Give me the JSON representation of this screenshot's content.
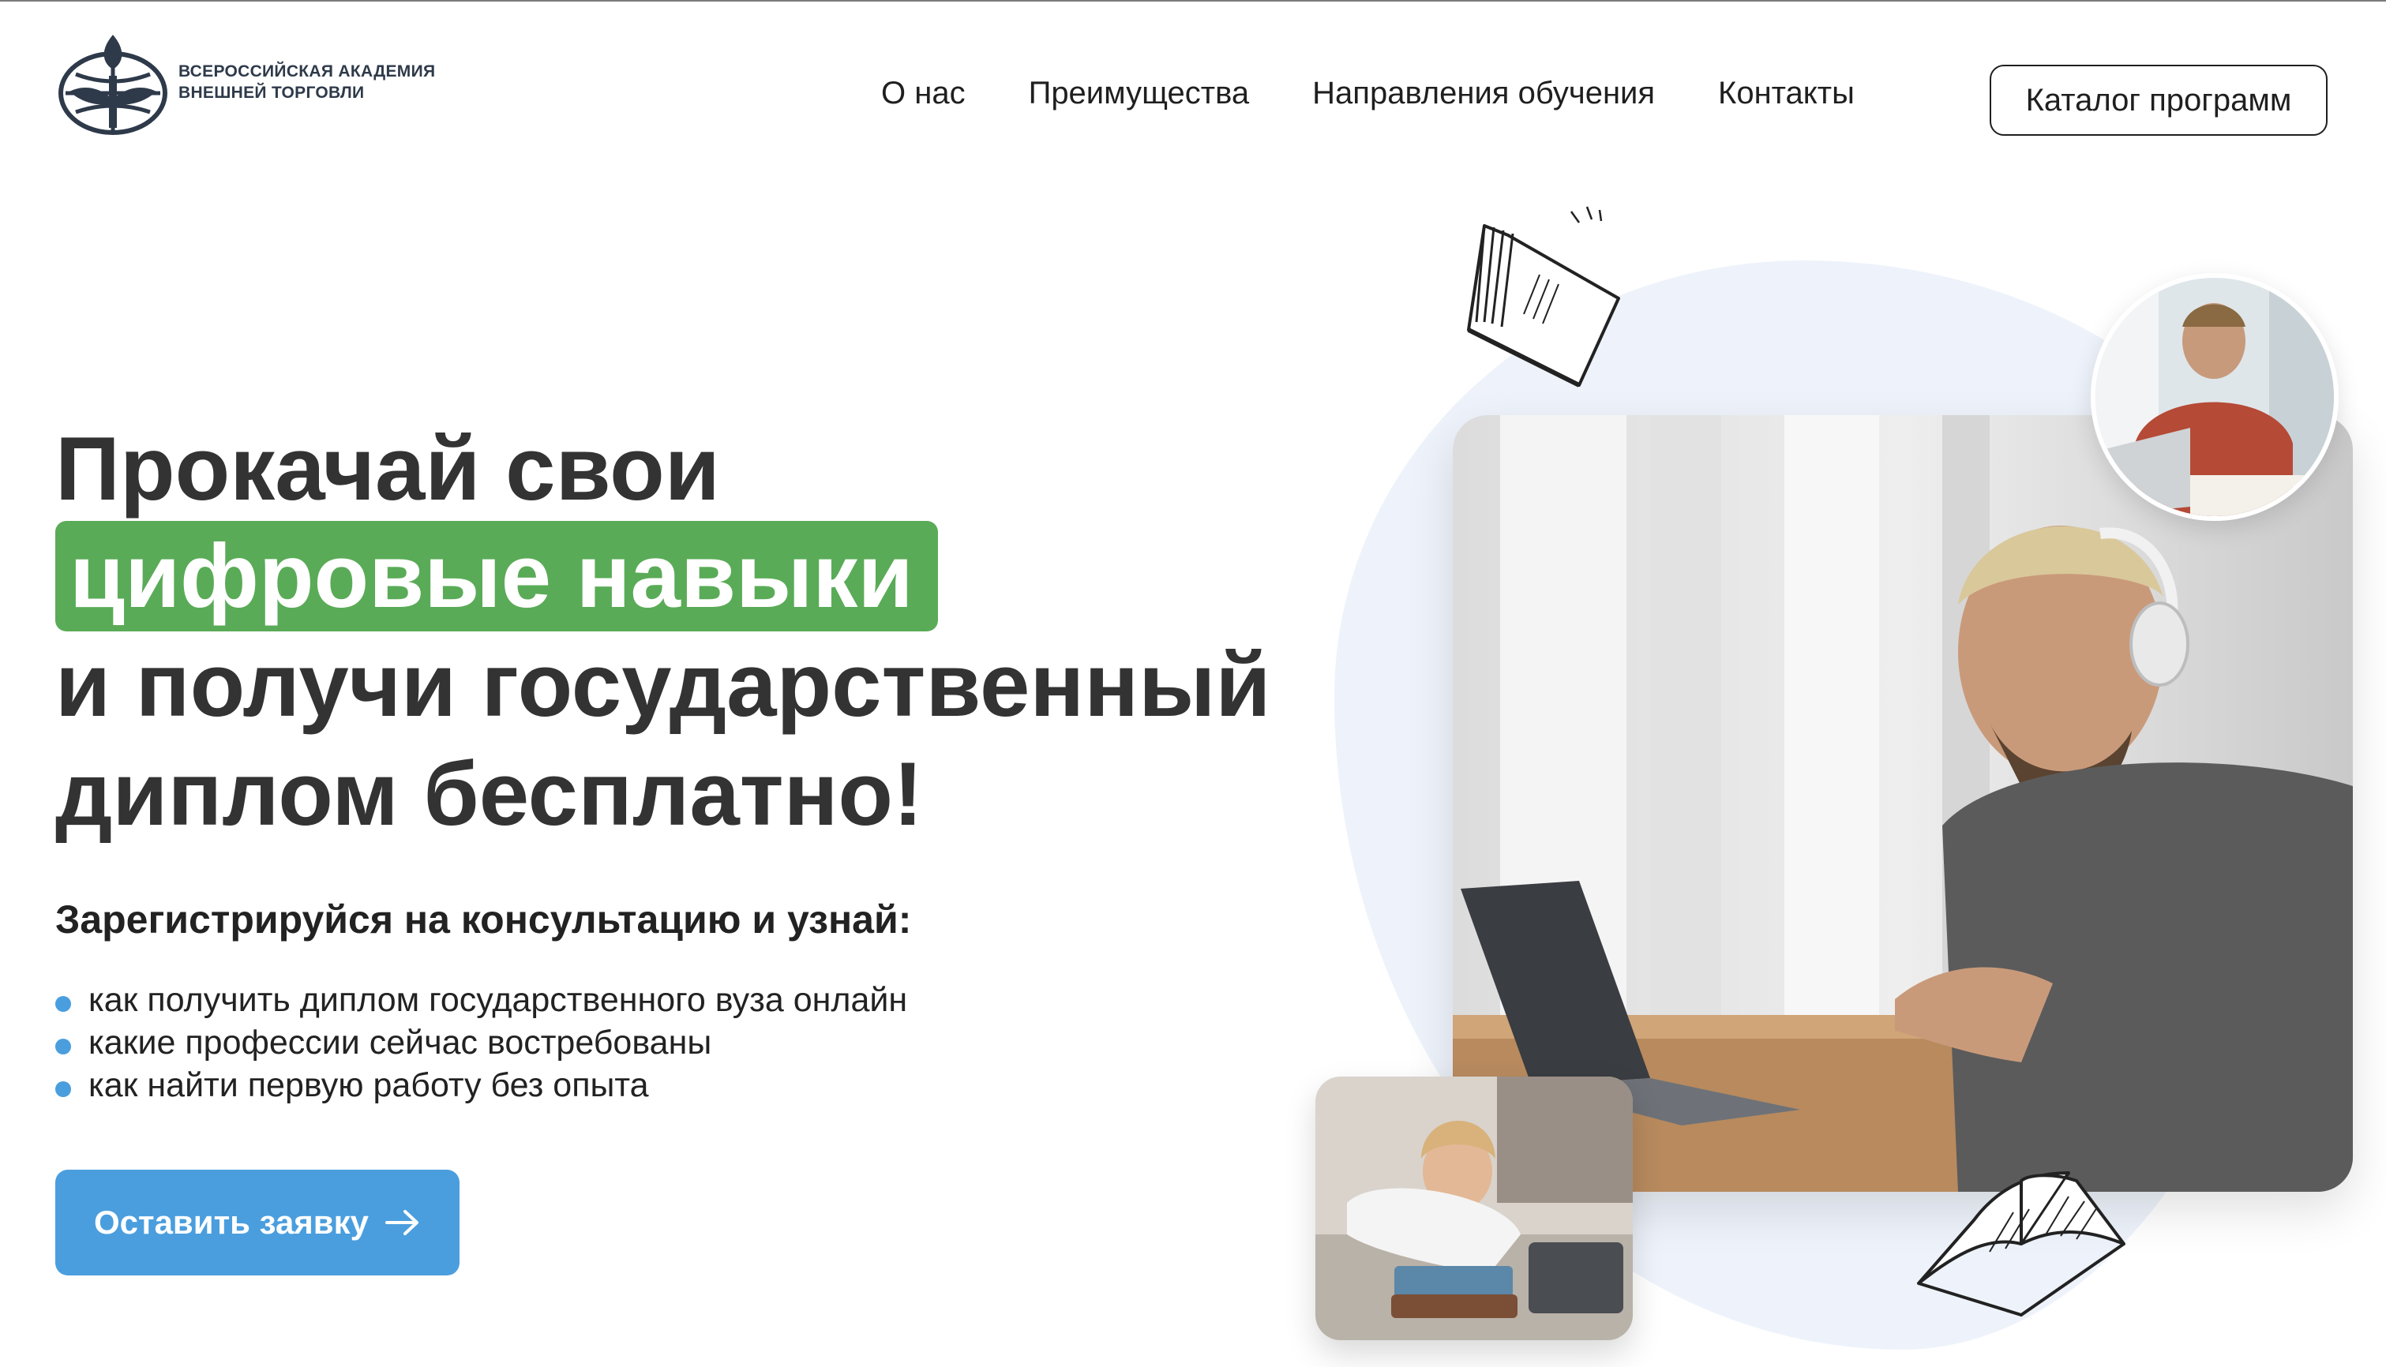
{
  "header": {
    "logo_line1": "Всероссийская академия",
    "logo_line2": "внешней торговли",
    "nav": [
      {
        "label": "О нас"
      },
      {
        "label": "Преимущества"
      },
      {
        "label": "Направления обучения"
      },
      {
        "label": "Контакты"
      }
    ],
    "catalog_button": "Каталог программ"
  },
  "hero": {
    "title_line1": "Прокачай свои",
    "title_highlight": "цифровые навыки",
    "title_line3": "и получи государственный",
    "title_line4": "диплом бесплатно!",
    "subheading": "Зарегистрируйся на консультацию и узнай:",
    "bullets": [
      "как получить диплом государственного вуза онлайн",
      "какие профессии сейчас востребованы",
      "как найти первую работу без опыта"
    ],
    "cta_label": "Оставить заявку"
  },
  "colors": {
    "accent_green": "#5aab57",
    "accent_blue": "#4a9ede",
    "text_dark": "#333333"
  },
  "icons": [
    "academy-logo-icon",
    "arrow-right-icon",
    "book-doodle-icon"
  ]
}
